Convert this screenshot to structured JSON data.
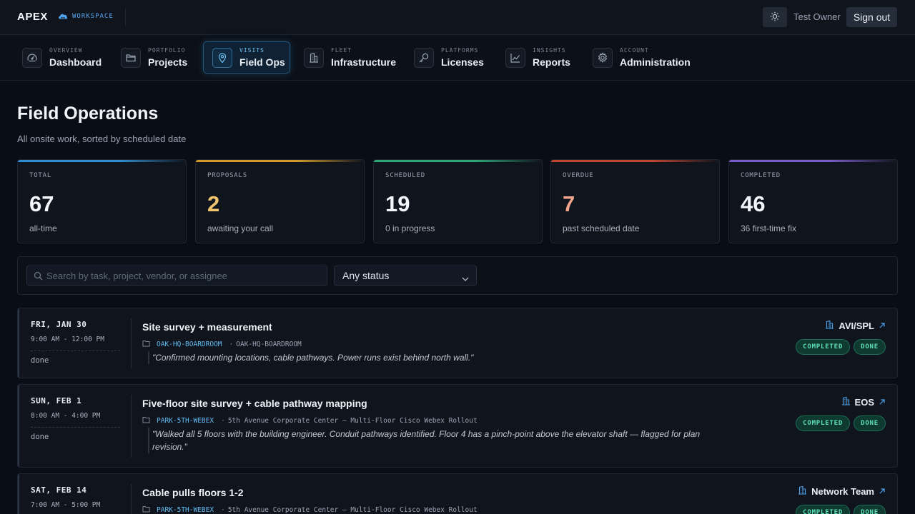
{
  "topbar": {
    "brand": "APEX",
    "workspace": "WORKSPACE",
    "theme_icon": "sun-icon",
    "user": "Test Owner",
    "sign_out": "Sign out"
  },
  "nav": {
    "items": [
      {
        "kicker": "OVERVIEW",
        "label": "Dashboard",
        "icon": "gauge-icon"
      },
      {
        "kicker": "PORTFOLIO",
        "label": "Projects",
        "icon": "folder-icon"
      },
      {
        "kicker": "VISITS",
        "label": "Field Ops",
        "icon": "map-pin-icon",
        "active": true
      },
      {
        "kicker": "FLEET",
        "label": "Infrastructure",
        "icon": "building-icon"
      },
      {
        "kicker": "PLATFORMS",
        "label": "Licenses",
        "icon": "key-icon"
      },
      {
        "kicker": "INSIGHTS",
        "label": "Reports",
        "icon": "trend-chart-icon"
      },
      {
        "kicker": "ACCOUNT",
        "label": "Administration",
        "icon": "gear-icon"
      }
    ]
  },
  "page": {
    "title": "Field Operations",
    "subtitle": "All onsite work, sorted by scheduled date"
  },
  "stats": [
    {
      "label": "TOTAL",
      "value": "67",
      "note": "all-time",
      "accent": "#2f8fd0",
      "value_color": "#f3f6fb"
    },
    {
      "label": "PROPOSALS",
      "value": "2",
      "note": "awaiting your call",
      "accent": "#d19a2a",
      "value_color": "#f2c46d"
    },
    {
      "label": "SCHEDULED",
      "value": "19",
      "note": "0 in progress",
      "accent": "#2fa678",
      "value_color": "#f3f6fb"
    },
    {
      "label": "OVERDUE",
      "value": "7",
      "note": "past scheduled date",
      "accent": "#c0452f",
      "value_color": "#f0a48c"
    },
    {
      "label": "COMPLETED",
      "value": "46",
      "note": "36 first-time fix",
      "accent": "#7a5bc7",
      "value_color": "#f3f6fb"
    }
  ],
  "filters": {
    "search_placeholder": "Search by task, project, vendor, or assignee",
    "status_value": "Any status"
  },
  "visits": [
    {
      "date": "FRI, JAN 30",
      "time": "9:00 AM - 12:00 PM",
      "status": "done",
      "title": "Site survey + measurement",
      "code": "OAK-HQ-BOARDROOM",
      "project": "OAK-HQ-BOARDROOM",
      "note": "\"Confirmed mounting locations, cable pathways. Power runs exist behind north wall.\"",
      "vendor": "AVI/SPL",
      "badges": [
        "COMPLETED",
        "DONE"
      ]
    },
    {
      "date": "SUN, FEB 1",
      "time": "8:00 AM - 4:00 PM",
      "status": "done",
      "title": "Five-floor site survey + cable pathway mapping",
      "code": "PARK-5TH-WEBEX",
      "project": "5th Avenue Corporate Center — Multi-Floor Cisco Webex Rollout",
      "note": "\"Walked all 5 floors with the building engineer. Conduit pathways identified. Floor 4 has a pinch-point above the elevator shaft — flagged for plan revision.\"",
      "vendor": "EOS",
      "badges": [
        "COMPLETED",
        "DONE"
      ]
    },
    {
      "date": "SAT, FEB 14",
      "time": "7:00 AM - 5:00 PM",
      "status": "",
      "title": "Cable pulls floors 1-2",
      "code": "PARK-5TH-WEBEX",
      "project": "5th Avenue Corporate Center — Multi-Floor Cisco Webex Rollout",
      "note": "",
      "vendor": "Network Team",
      "badges": [
        "COMPLETED",
        "DONE"
      ]
    }
  ]
}
